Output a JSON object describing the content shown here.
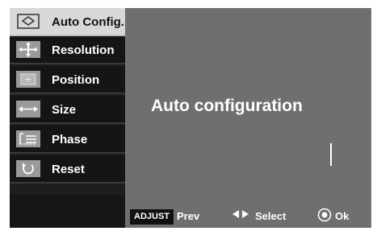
{
  "menu": {
    "items": [
      {
        "label": "Auto Config.",
        "icon": "auto-config-icon",
        "active": true
      },
      {
        "label": "Resolution",
        "icon": "move-arrows-icon",
        "active": false
      },
      {
        "label": "Position",
        "icon": "position-icon",
        "active": false
      },
      {
        "label": "Size",
        "icon": "size-arrows-icon",
        "active": false
      },
      {
        "label": "Phase",
        "icon": "phase-icon",
        "active": false
      },
      {
        "label": "Reset",
        "icon": "reset-icon",
        "active": false
      }
    ]
  },
  "content": {
    "title": "Auto configuration"
  },
  "footer": {
    "adjust": "ADJUST",
    "prev": "Prev",
    "select": "Select",
    "ok": "Ok"
  },
  "colors": {
    "panel": "#6f6f6f",
    "sidebar": "#151515",
    "active_item": "#d8d8d8"
  }
}
